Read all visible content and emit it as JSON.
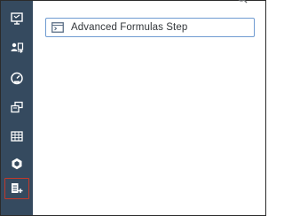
{
  "sidebar": {
    "items": [
      {
        "icon": "presentation-icon"
      },
      {
        "icon": "user-transfer-icon"
      },
      {
        "icon": "speedometer-icon"
      },
      {
        "icon": "copy-screens-icon"
      },
      {
        "icon": "data-table-icon"
      },
      {
        "icon": "hexagon-cube-icon"
      },
      {
        "icon": "add-document-icon",
        "selected": true
      }
    ]
  },
  "main": {
    "step_card": {
      "label": "Advanced Formulas Step",
      "icon": "formula-window-icon"
    }
  },
  "colors": {
    "sidebar_bg": "#354a5f",
    "icon_color": "#ffffff",
    "card_border": "#6f9bd1",
    "selected_outline": "#c0392b",
    "text": "#32363a"
  }
}
